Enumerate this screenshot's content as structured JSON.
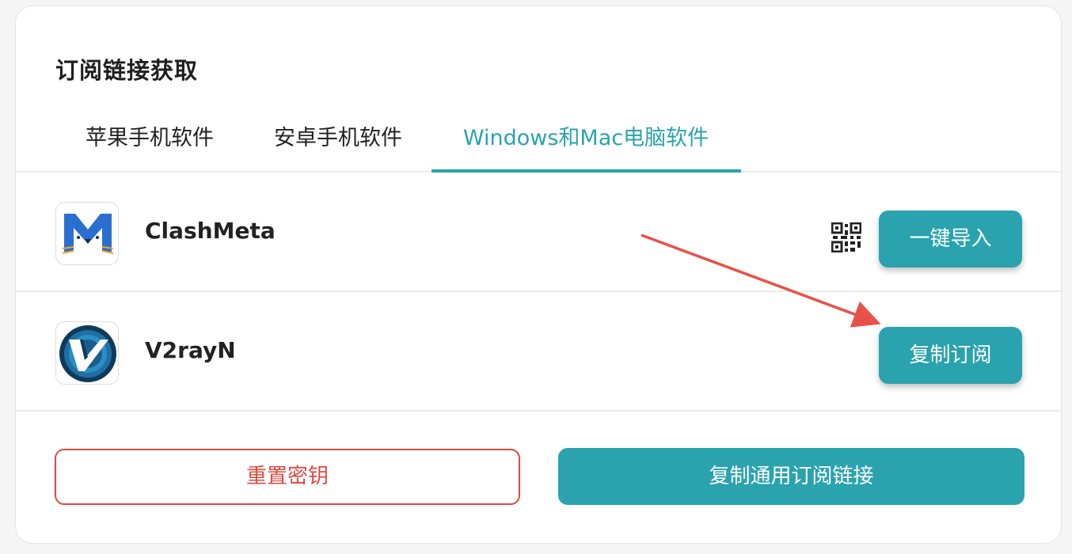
{
  "panel": {
    "title": "订阅链接获取"
  },
  "tabs": [
    {
      "label": "苹果手机软件",
      "active": false
    },
    {
      "label": "安卓手机软件",
      "active": false
    },
    {
      "label": "Windows和Mac电脑软件",
      "active": true
    }
  ],
  "apps": [
    {
      "name": "ClashMeta",
      "icon": "clashmeta-logo",
      "has_qr": true,
      "button_label": "一键导入"
    },
    {
      "name": "V2rayN",
      "icon": "v2rayn-logo",
      "has_qr": false,
      "button_label": "复制订阅"
    }
  ],
  "actions": {
    "reset_label": "重置密钥",
    "copy_all_label": "复制通用订阅链接"
  },
  "colors": {
    "accent": "#2aa3ae",
    "danger": "#e2483f",
    "annotation_arrow": "#e8514a"
  }
}
